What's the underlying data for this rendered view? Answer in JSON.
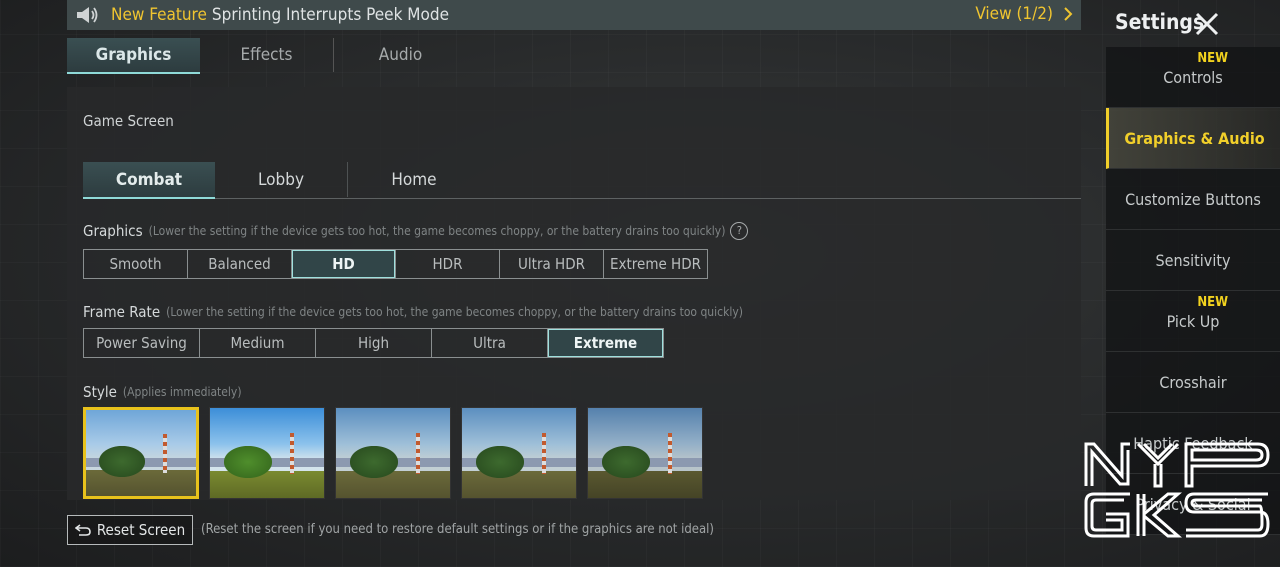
{
  "banner": {
    "new_feature_label": "New Feature",
    "text": "Sprinting Interrupts Peek Mode",
    "view_label": "View (1/2)",
    "icons": {
      "speaker": "speaker-icon",
      "next": "chevron-right-icon"
    }
  },
  "main_tabs": [
    "Graphics",
    "Effects",
    "Audio"
  ],
  "game_screen_label": "Game Screen",
  "sub_tabs": [
    "Combat",
    "Lobby",
    "Home"
  ],
  "graphics": {
    "title": "Graphics",
    "hint": "(Lower the setting if the device gets too hot, the game becomes choppy, or the battery drains too quickly)",
    "help_glyph": "?",
    "options": [
      "Smooth",
      "Balanced",
      "HD",
      "HDR",
      "Ultra HDR",
      "Extreme HDR"
    ],
    "selected": "HD"
  },
  "frame_rate": {
    "title": "Frame Rate",
    "hint": "(Lower the setting if the device gets too hot, the game becomes choppy, or the battery drains too quickly)",
    "options": [
      "Power Saving",
      "Medium",
      "High",
      "Ultra",
      "Extreme"
    ],
    "selected": "Extreme"
  },
  "style": {
    "title": "Style",
    "hint": "(Applies immediately)",
    "count": 5,
    "selected_index": 0
  },
  "reset": {
    "button_label": "Reset Screen",
    "note": "(Reset the screen if you need to restore default settings or if the graphics are not ideal)",
    "icon": "undo-icon"
  },
  "sidebar": {
    "title": "Settings",
    "close_icon": "close-icon",
    "new_badge": "NEW",
    "items": [
      {
        "label": "Controls",
        "badge": "NEW"
      },
      {
        "label": "Graphics & Audio",
        "active": true
      },
      {
        "label": "Customize Buttons"
      },
      {
        "label": "Sensitivity"
      },
      {
        "label": "Pick Up",
        "badge": "NEW"
      },
      {
        "label": "Crosshair"
      },
      {
        "label": "Haptic Feedback"
      },
      {
        "label": "Privacy & Social"
      }
    ]
  },
  "watermark": {
    "line1": "NYP",
    "line2": "GKS"
  },
  "colors": {
    "accent_yellow": "#f0c530",
    "selected_teal": "#8fdad8",
    "banner_bg": "#3f4a4b"
  }
}
